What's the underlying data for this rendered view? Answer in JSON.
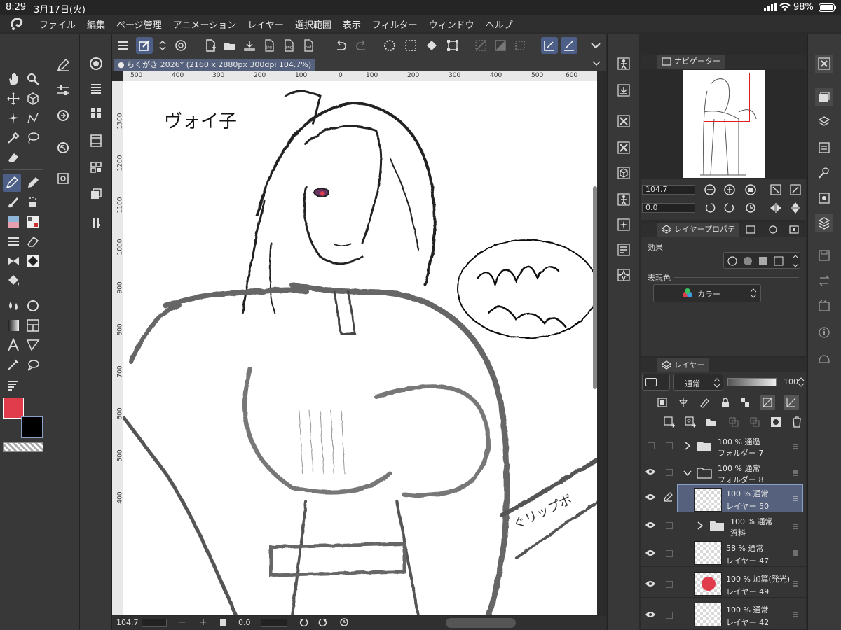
{
  "status": {
    "time": "8:29",
    "date": "3月17日(火)",
    "battery": "98%"
  },
  "menu": [
    "ファイル",
    "編集",
    "ページ管理",
    "アニメーション",
    "レイヤー",
    "選択範囲",
    "表示",
    "フィルター",
    "ウィンドウ",
    "ヘルプ"
  ],
  "document": {
    "title": "らくがき 2026* (2160 x 2880px 300dpi 104.7%)"
  },
  "ruler_top": [
    "500",
    "400",
    "300",
    "200",
    "100",
    "0",
    "100",
    "200",
    "300",
    "400",
    "500",
    "600"
  ],
  "ruler_left": [
    "1300",
    "1200",
    "1100",
    "1000",
    "900",
    "800",
    "700",
    "600",
    "500",
    "400"
  ],
  "canvas": {
    "handwriting_top": "ヴォイ子",
    "side_text": "ぐリップボ"
  },
  "bottom": {
    "zoom": "104.7",
    "minus": "−",
    "plus": "+",
    "angle": "0.0"
  },
  "navigator": {
    "tab": "ナビゲーター",
    "zoom_value": "104.7",
    "angle_value": "0.0"
  },
  "props": {
    "tab": "レイヤープロパテ",
    "effect_label": "効果",
    "color_label": "表現色",
    "color_value": "カラー"
  },
  "layers_panel": {
    "tab": "レイヤー",
    "blend_mode": "通常",
    "opacity": "100",
    "rows": [
      {
        "line1": "100 % 通過",
        "line2": "フォルダー 7"
      },
      {
        "line1": "100 % 通常",
        "line2": "フォルダー 8"
      },
      {
        "line1": "100 % 通常",
        "line2": "レイヤー 50"
      },
      {
        "line1": "100 % 通常",
        "line2": "資料"
      },
      {
        "line1": "58 % 通常",
        "line2": "レイヤー 47"
      },
      {
        "line1": "100 % 加算(発光)",
        "line2": "レイヤー 49"
      },
      {
        "line1": "100 % 通常",
        "line2": "レイヤー 42"
      }
    ]
  },
  "colors": {
    "main": "#e03c4c",
    "sub": "#000000",
    "accent": "#4d5f86"
  }
}
